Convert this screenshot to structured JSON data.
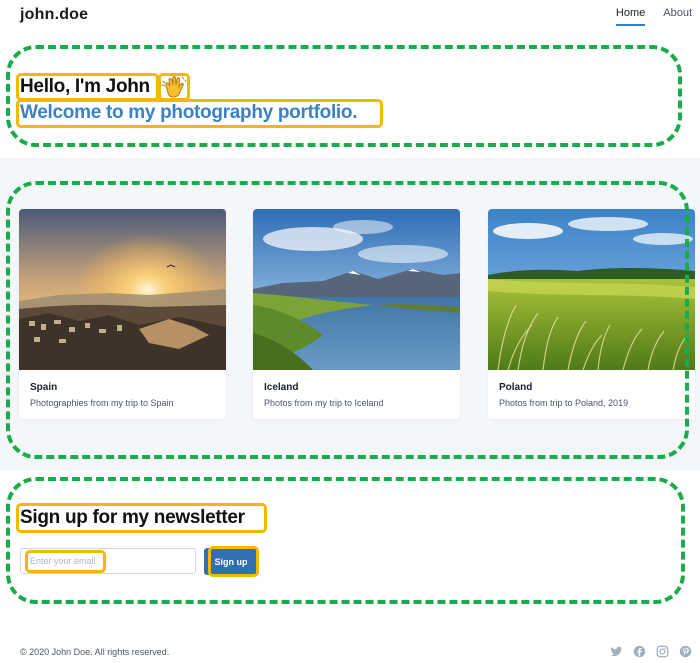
{
  "nav": {
    "brand": "john.doe",
    "links": [
      {
        "label": "Home",
        "active": true
      },
      {
        "label": "About",
        "active": false
      }
    ]
  },
  "hero": {
    "title": "Hello, I'm John",
    "emoji_icon": "waving-hand-icon",
    "subtitle": "Welcome to my photography portfolio."
  },
  "cards": [
    {
      "title": "Spain",
      "description": "Photographies from my trip to Spain",
      "image": "spain-sunset-city-photo"
    },
    {
      "title": "Iceland",
      "description": "Photos from my trip to Iceland",
      "image": "iceland-fjord-photo"
    },
    {
      "title": "Poland",
      "description": "Photos from trip to Poland, 2019",
      "image": "poland-field-photo"
    }
  ],
  "newsletter": {
    "title": "Sign up for my newsletter",
    "email_placeholder": "Enter your email",
    "email_value": "",
    "button_label": "Sign up"
  },
  "footer": {
    "copyright": "© 2020 John Doe. All rights reserved.",
    "social_icons": [
      "twitter-icon",
      "facebook-icon",
      "instagram-icon",
      "pinterest-icon"
    ]
  },
  "colors": {
    "accent_blue": "#3b82c4",
    "button_blue": "#2f6fb3",
    "annotation_green": "#1aab4a",
    "annotation_yellow": "#f5b800",
    "band_background": "#f4f7fa"
  }
}
